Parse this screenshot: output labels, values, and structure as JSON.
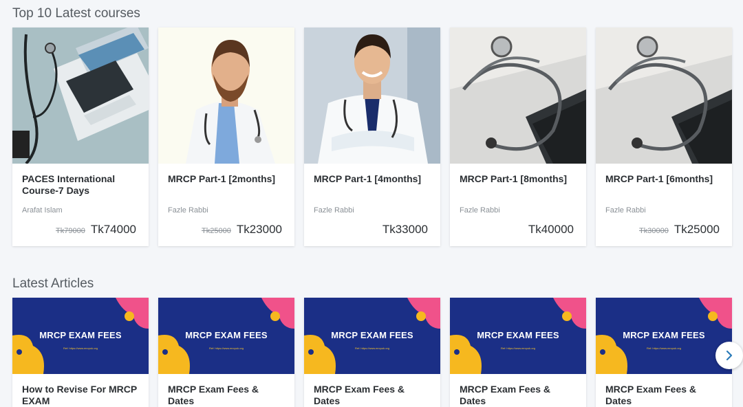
{
  "sections": {
    "courses_title": "Top 10 Latest courses",
    "articles_title": "Latest Articles"
  },
  "courses": [
    {
      "title": "PACES International Course-7 Days",
      "author": "Arafat Islam",
      "old_price": "Tk79000",
      "price": "Tk74000",
      "image": "laptop-stethoscope"
    },
    {
      "title": "MRCP Part-1 [2months]",
      "author": "Fazle Rabbi",
      "old_price": "Tk25000",
      "price": "Tk23000",
      "image": "doctor-beard"
    },
    {
      "title": "MRCP Part-1 [4months]",
      "author": "Fazle Rabbi",
      "old_price": "",
      "price": "Tk33000",
      "image": "doctor-smiling"
    },
    {
      "title": "MRCP Part-1 [8months]",
      "author": "Fazle Rabbi",
      "old_price": "",
      "price": "Tk40000",
      "image": "stethoscope-tablet"
    },
    {
      "title": "MRCP Part-1 [6months]",
      "author": "Fazle Rabbi",
      "old_price": "Tk30000",
      "price": "Tk25000",
      "image": "stethoscope-tablet"
    }
  ],
  "articles": [
    {
      "title": "How to Revise For MRCP EXAM",
      "image_heading": "MRCP EXAM FEES",
      "image_sub": "Ref: https://www.mrcpuk.org"
    },
    {
      "title": "MRCP Exam Fees & Dates",
      "image_heading": "MRCP EXAM FEES",
      "image_sub": "Ref: https://www.mrcpuk.org"
    },
    {
      "title": "MRCP Exam Fees & Dates",
      "image_heading": "MRCP EXAM FEES",
      "image_sub": "Ref: https://www.mrcpuk.org"
    },
    {
      "title": "MRCP Exam Fees & Dates",
      "image_heading": "MRCP EXAM FEES",
      "image_sub": "Ref: https://www.mrcpuk.org"
    },
    {
      "title": "MRCP Exam Fees & Dates",
      "image_heading": "MRCP EXAM FEES",
      "image_sub": "Ref: https://www.mrcpuk.org"
    }
  ],
  "controls": {
    "next_icon": "chevron-right-icon"
  },
  "colors": {
    "article_bg": "#1b2f86",
    "article_pink": "#f0528a",
    "article_yellow": "#f6b81f"
  }
}
